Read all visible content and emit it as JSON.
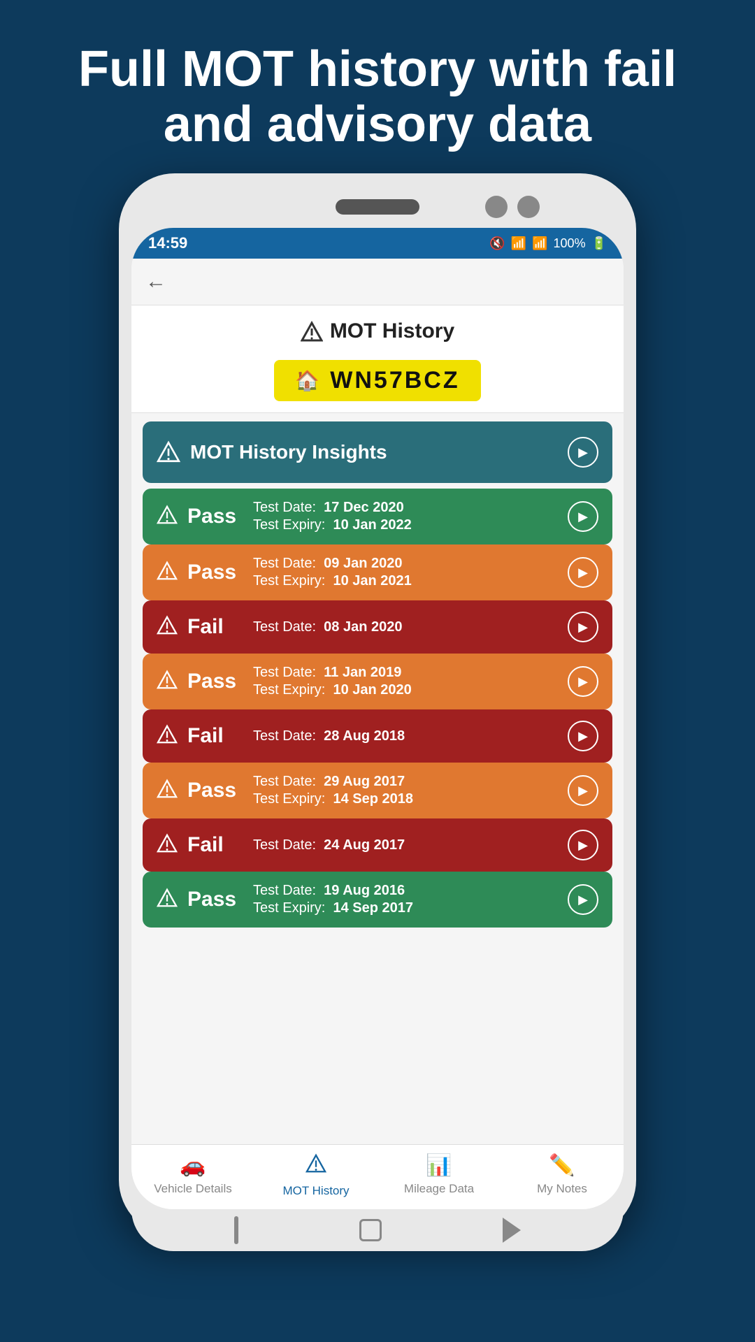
{
  "headline": "Full MOT history with fail and advisory data",
  "status_bar": {
    "time": "14:59",
    "battery": "100%",
    "icons": "🔇 📶 📶 🔋"
  },
  "page_header": {
    "title": "MOT History",
    "plate": "WN57BCZ"
  },
  "insights_card": {
    "title": "MOT History Insights"
  },
  "mot_entries": [
    {
      "result": "Pass",
      "color": "pass-green",
      "test_date": "17 Dec 2020",
      "expiry_date": "10 Jan 2022",
      "has_expiry": true
    },
    {
      "result": "Pass",
      "color": "pass-orange",
      "test_date": "09 Jan 2020",
      "expiry_date": "10 Jan 2021",
      "has_expiry": true
    },
    {
      "result": "Fail",
      "color": "fail-dark",
      "test_date": "08 Jan 2020",
      "expiry_date": null,
      "has_expiry": false
    },
    {
      "result": "Pass",
      "color": "pass-orange",
      "test_date": "11 Jan 2019",
      "expiry_date": "10 Jan 2020",
      "has_expiry": true
    },
    {
      "result": "Fail",
      "color": "fail-dark",
      "test_date": "28 Aug 2018",
      "expiry_date": null,
      "has_expiry": false
    },
    {
      "result": "Pass",
      "color": "pass-orange",
      "test_date": "29 Aug 2017",
      "expiry_date": "14 Sep 2018",
      "has_expiry": true
    },
    {
      "result": "Fail",
      "color": "fail-dark",
      "test_date": "24 Aug 2017",
      "expiry_date": null,
      "has_expiry": false
    },
    {
      "result": "Pass",
      "color": "pass-green",
      "test_date": "19 Aug 2016",
      "expiry_date": "14 Sep 2017",
      "has_expiry": true
    }
  ],
  "bottom_nav": [
    {
      "label": "Vehicle Details",
      "icon": "car",
      "active": false
    },
    {
      "label": "MOT History",
      "icon": "hazard",
      "active": true
    },
    {
      "label": "Mileage Data",
      "icon": "chart",
      "active": false
    },
    {
      "label": "My Notes",
      "icon": "pencil",
      "active": false
    }
  ],
  "labels": {
    "test_date_prefix": "Test Date:",
    "expiry_prefix": "Test Expiry:"
  }
}
